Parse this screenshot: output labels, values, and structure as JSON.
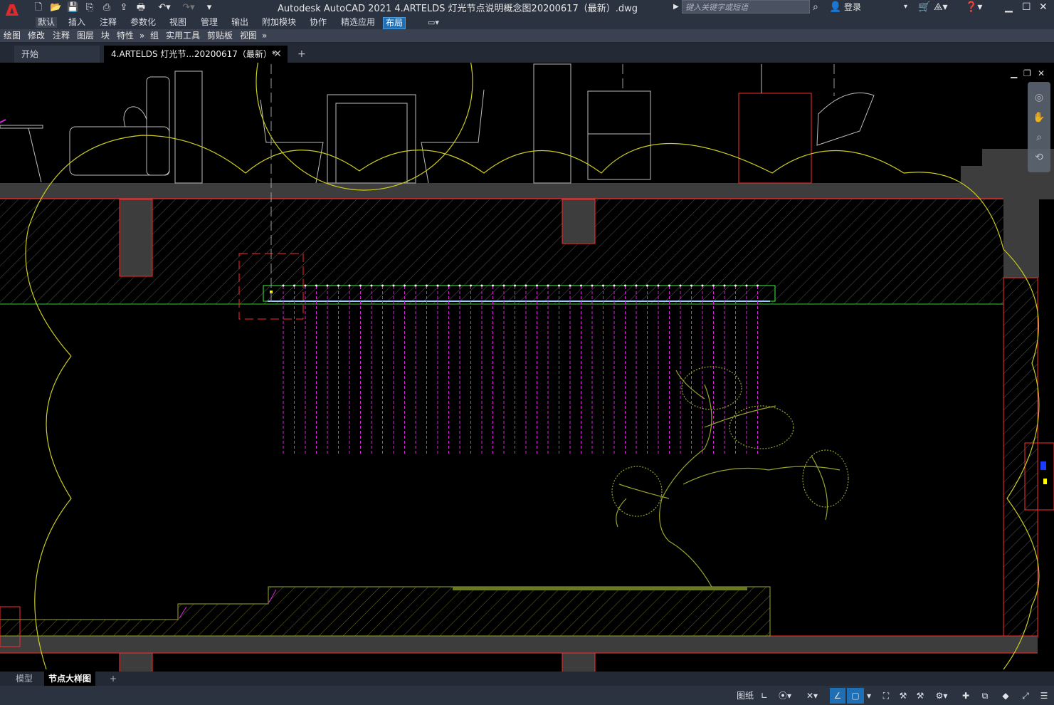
{
  "app": {
    "title": "Autodesk AutoCAD 2021    4.ARTELDS 灯光节点说明概念图20200617（最新）.dwg",
    "logo_letter": "A",
    "search_placeholder": "键入关键字或短语",
    "login_label": "登录"
  },
  "ribbon_tabs": [
    "默认",
    "插入",
    "注释",
    "参数化",
    "视图",
    "管理",
    "输出",
    "附加模块",
    "协作",
    "精选应用",
    "布局"
  ],
  "panel_tabs": [
    "绘图",
    "修改",
    "注释",
    "图层",
    "块",
    "特性",
    "»",
    "组",
    "实用工具",
    "剪贴板",
    "视图",
    "»"
  ],
  "file_tabs": {
    "start": "开始",
    "document": "4.ARTELDS 灯光节...20200617（最新）*",
    "close": "✕",
    "new": "+"
  },
  "layout_tabs": {
    "model": "模型",
    "active": "节点大样图",
    "add": "+"
  },
  "status": {
    "paper": "图纸"
  },
  "viewport_controls": {
    "minimize": "▁",
    "restore": "❐",
    "close": "✕"
  },
  "colors": {
    "title_bg": "#2b3240",
    "canvas_bg": "#000000",
    "wall_fill": "#3d3d3d",
    "red_line": "#ff2a2a",
    "yellow_cloud": "#cccc22",
    "magenta": "#dd22dd",
    "green": "#33cc33",
    "furniture": "#bdbdbd",
    "tree": "#9aa32a",
    "accent_blue": "#1f6fb5"
  }
}
